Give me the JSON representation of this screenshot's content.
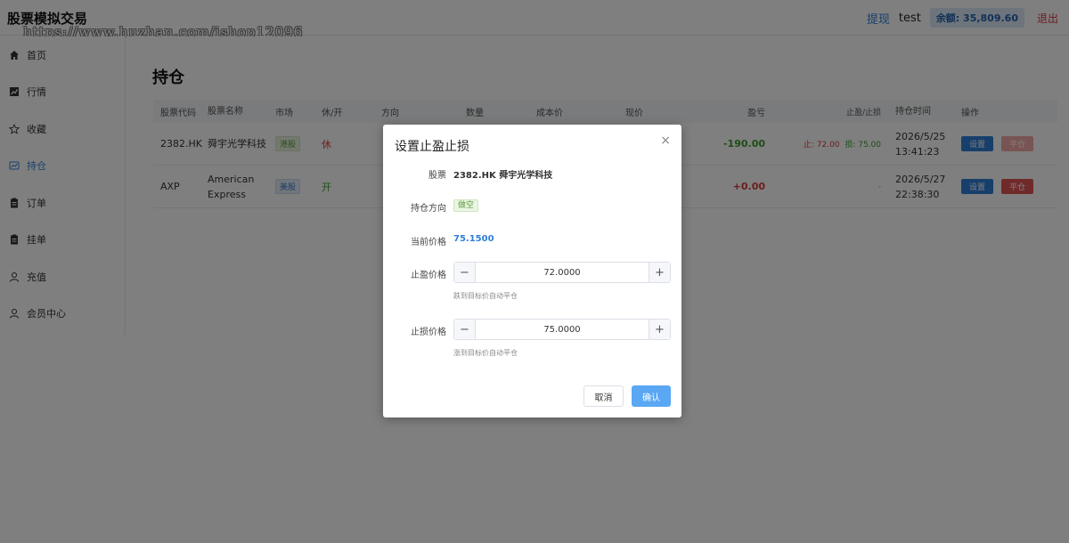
{
  "header": {
    "title": "股票模拟交易",
    "watermark": "https://www.huzhan.com/ishop12096",
    "withdraw": "提现",
    "username": "test",
    "balance": "余额: 35,809.60",
    "logout": "退出"
  },
  "sidebar": {
    "items": [
      {
        "label": "首页",
        "icon": "home-icon"
      },
      {
        "label": "行情",
        "icon": "chart-icon"
      },
      {
        "label": "收藏",
        "icon": "star-icon"
      },
      {
        "label": "持仓",
        "icon": "holdings-icon"
      },
      {
        "label": "订单",
        "icon": "clipboard-icon"
      },
      {
        "label": "挂单",
        "icon": "clipboard-icon"
      },
      {
        "label": "充值",
        "icon": "user-icon"
      },
      {
        "label": "会员中心",
        "icon": "user-icon"
      }
    ],
    "active": "持仓"
  },
  "main": {
    "title": "持仓",
    "columns": [
      "股票代码",
      "股票名称",
      "市场",
      "休/开",
      "方向",
      "数量",
      "成本价",
      "现价",
      "盈亏",
      "止盈/止损",
      "持仓时间",
      "操作"
    ],
    "rows": [
      {
        "code": "2382.HK",
        "name": "舜宇光学科技",
        "market": "港股",
        "status": "休",
        "pnl": "-190.00",
        "sltp_tp": "止: 72.00",
        "sltp_sl": "损: 75.00",
        "date": "2026/5/25",
        "time": "13:41:23",
        "set": "设置",
        "close": "平仓"
      },
      {
        "code": "AXP",
        "name": "American Express",
        "market": "美股",
        "status": "开",
        "pnl": "+0.00",
        "sltp": "-",
        "date": "2026/5/27",
        "time": "22:38:30",
        "set": "设置",
        "close": "平仓"
      }
    ]
  },
  "dialog": {
    "title": "设置止盈止损",
    "close": "×",
    "stock_label": "股票",
    "stock_value": "2382.HK 舜宇光学科技",
    "direction_label": "持仓方向",
    "direction_value": "做空",
    "price_label": "当前价格",
    "price_value": "75.1500",
    "tp_label": "止盈价格",
    "tp_value": "72.0000",
    "tp_hint": "跌到目标价自动平仓",
    "sl_label": "止损价格",
    "sl_value": "75.0000",
    "sl_hint": "涨到目标价自动平仓",
    "minus": "−",
    "plus": "+",
    "cancel": "取消",
    "confirm": "确认"
  }
}
